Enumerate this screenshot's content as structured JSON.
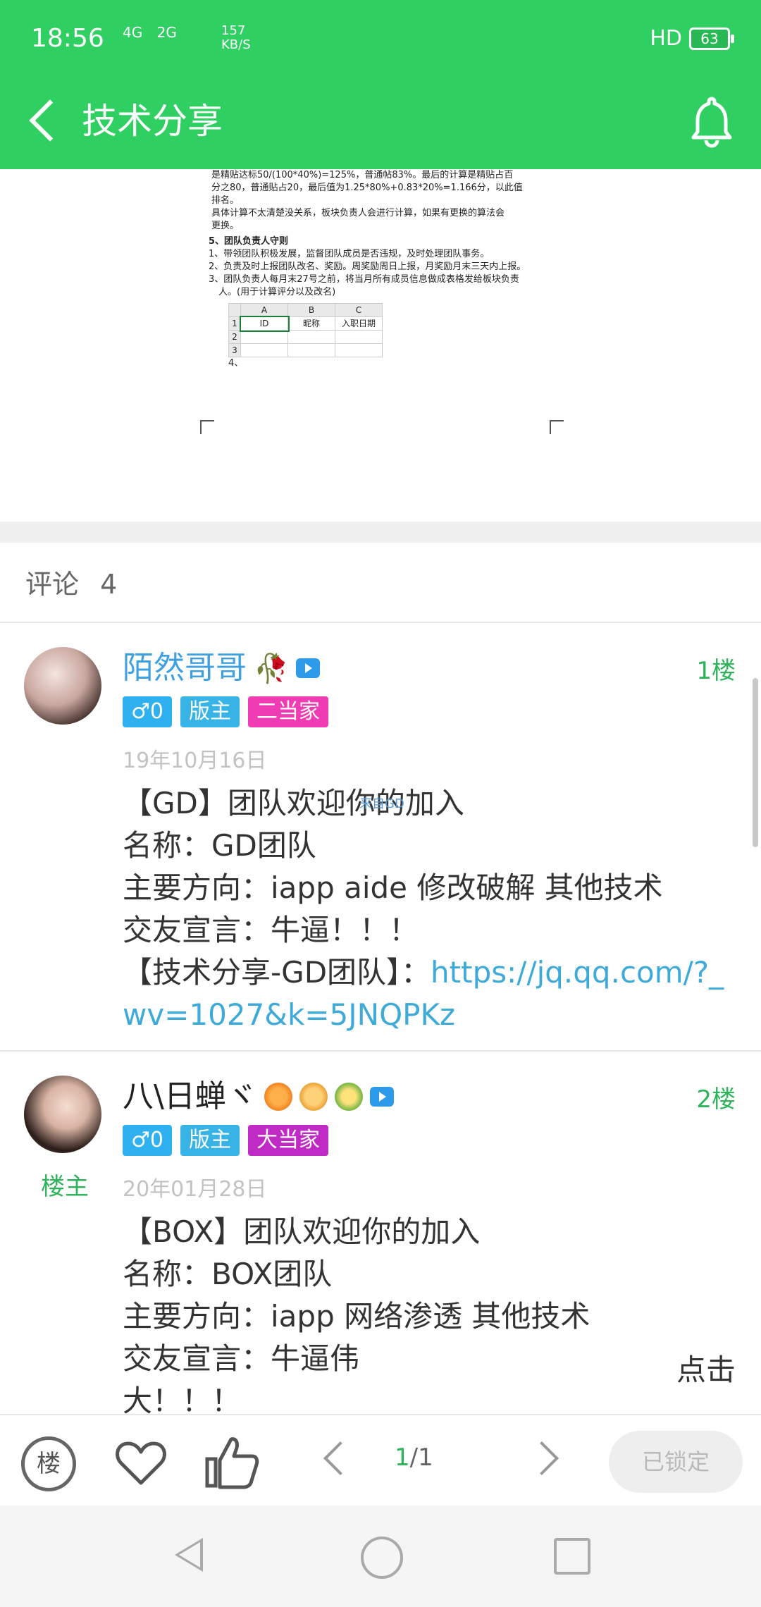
{
  "status_bar": {
    "time": "18:56",
    "signal1": "4G",
    "signal2": "2G",
    "speed_value": "157",
    "speed_unit": "KB/S",
    "hd": "HD",
    "battery": "63"
  },
  "titlebar": {
    "title": "技术分享",
    "back_icon": "chevron-left-icon",
    "bell_icon": "bell-icon"
  },
  "preview": {
    "lines": [
      "是精贴达标50/(100*40%)=125%，普通帖83%。最后的计算是精贴占百",
      "分之80，普通贴占20，最后值为1.25*80%+0.83*20%=1.166分，以此值",
      "排名。",
      "具体计算不太清楚没关系，板块负责人会进行计算，如果有更换的算法会",
      "更换。"
    ],
    "section_title": "5、团队负责人守则",
    "rules": [
      "1、带领团队积极发展，监督团队成员是否违规，及时处理团队事务。",
      "2、负责及时上报团队改名、奖励。周奖励周日上报，月奖励月末三天内上报。",
      "3、团队负责人每月末27号之前，将当月所有成员信息做成表格发给板块负责",
      "人。(用于计算评分以及改名)"
    ],
    "table": {
      "cols": [
        "A",
        "B",
        "C"
      ],
      "rows": [
        "1",
        "2",
        "3"
      ],
      "header_cells": [
        "ID",
        "昵称",
        "入职日期"
      ]
    },
    "item4": "4、"
  },
  "comments": {
    "label": "评论",
    "count": "4"
  },
  "comment1": {
    "name": "陌然哥哥",
    "emoji": "🥀",
    "floor": "1楼",
    "gender_badge": "♂0",
    "role_badge": "版主",
    "rank_badge": "二当家",
    "date": "19年10月16日",
    "lines": [
      "【GD】团队欢迎你的加入",
      "名称：GD团队",
      "主要方向：iapp  aide  修改破解  其他技术",
      "交友宣言：牛逼！！！"
    ],
    "link_prefix": "【技术分享-GD团队】：",
    "link_text": "https://jq.qq.com/?_wv=1027&k=5JNQPKz",
    "watermark": "来自GD"
  },
  "comment2": {
    "name": "八\\日蝉ヾ",
    "floor": "2楼",
    "owner_tag": "楼主",
    "gender_badge": "♂0",
    "role_badge": "版主",
    "rank_badge": "大当家",
    "date": "20年01月28日",
    "lines": [
      "【BOX】团队欢迎你的加入",
      "名称：BOX团队",
      "主要方向：iapp    网络渗透  其他技术",
      "交友宣言：牛逼伟",
      "大！！！"
    ],
    "more": "点击"
  },
  "actionbar": {
    "louzhu_label": "楼",
    "page_current": "1",
    "page_total": "/1",
    "locked_label": "已锁定"
  }
}
